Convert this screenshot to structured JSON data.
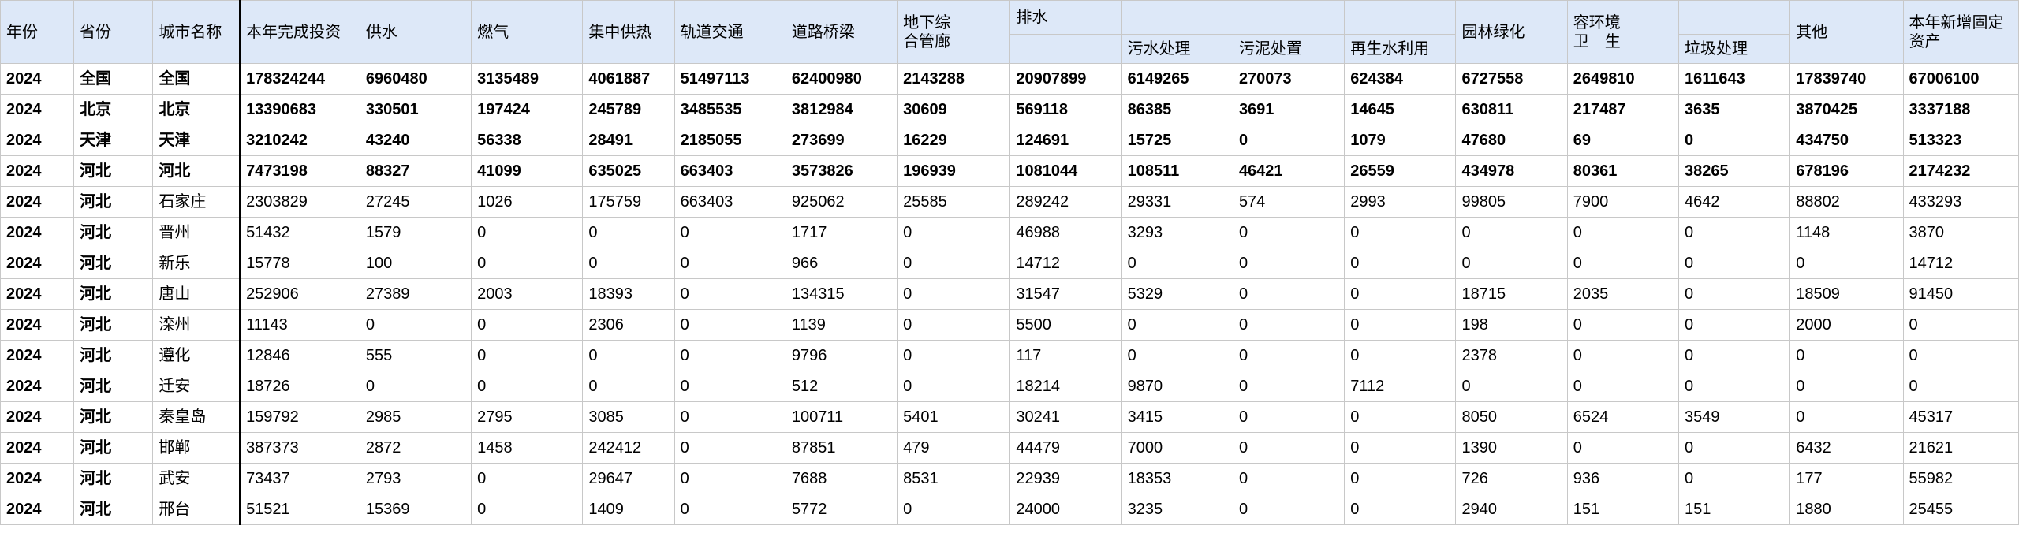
{
  "headers": {
    "year": "年份",
    "province": "省份",
    "city": "城市名称",
    "invest": "本年完成投资",
    "water": "供水",
    "gas": "燃气",
    "heat": "集中供热",
    "rail": "轨道交通",
    "road": "道路桥梁",
    "pipe_line1": "地下综",
    "pipe_line2": "合管廊",
    "drain": "排水",
    "sewage": "污水处理",
    "sludge": "污泥处置",
    "reuse": "再生水利用",
    "green": "园林绿化",
    "env_line1": "容环境",
    "env_line2": "卫　生",
    "garbage": "垃圾处理",
    "other": "其他",
    "fixed_line1": "本年新增固定",
    "fixed_line2": "资产"
  },
  "rows": [
    {
      "bold": true,
      "cells": [
        "2024",
        "全国",
        "全国",
        "178324244",
        "6960480",
        "3135489",
        "4061887",
        "51497113",
        "62400980",
        "2143288",
        "20907899",
        "6149265",
        "270073",
        "624384",
        "6727558",
        "2649810",
        "1611643",
        "17839740",
        "67006100"
      ]
    },
    {
      "bold": true,
      "cells": [
        "2024",
        "北京",
        "北京",
        "13390683",
        "330501",
        "197424",
        "245789",
        "3485535",
        "3812984",
        "30609",
        "569118",
        "86385",
        "3691",
        "14645",
        "630811",
        "217487",
        "3635",
        "3870425",
        "3337188"
      ]
    },
    {
      "bold": true,
      "cells": [
        "2024",
        "天津",
        "天津",
        "3210242",
        "43240",
        "56338",
        "28491",
        "2185055",
        "273699",
        "16229",
        "124691",
        "15725",
        "0",
        "1079",
        "47680",
        "69",
        "0",
        "434750",
        "513323"
      ]
    },
    {
      "bold": true,
      "cells": [
        "2024",
        "河北",
        "河北",
        "7473198",
        "88327",
        "41099",
        "635025",
        "663403",
        "3573826",
        "196939",
        "1081044",
        "108511",
        "46421",
        "26559",
        "434978",
        "80361",
        "38265",
        "678196",
        "2174232"
      ]
    },
    {
      "bold": false,
      "cells": [
        "2024",
        "河北",
        "石家庄",
        "2303829",
        "27245",
        "1026",
        "175759",
        "663403",
        "925062",
        "25585",
        "289242",
        "29331",
        "574",
        "2993",
        "99805",
        "7900",
        "4642",
        "88802",
        "433293"
      ]
    },
    {
      "bold": false,
      "cells": [
        "2024",
        "河北",
        "晋州",
        "51432",
        "1579",
        "0",
        "0",
        "0",
        "1717",
        "0",
        "46988",
        "3293",
        "0",
        "0",
        "0",
        "0",
        "0",
        "1148",
        "3870"
      ]
    },
    {
      "bold": false,
      "cells": [
        "2024",
        "河北",
        "新乐",
        "15778",
        "100",
        "0",
        "0",
        "0",
        "966",
        "0",
        "14712",
        "0",
        "0",
        "0",
        "0",
        "0",
        "0",
        "0",
        "14712"
      ]
    },
    {
      "bold": false,
      "cells": [
        "2024",
        "河北",
        "唐山",
        "252906",
        "27389",
        "2003",
        "18393",
        "0",
        "134315",
        "0",
        "31547",
        "5329",
        "0",
        "0",
        "18715",
        "2035",
        "0",
        "18509",
        "91450"
      ]
    },
    {
      "bold": false,
      "cells": [
        "2024",
        "河北",
        "滦州",
        "11143",
        "0",
        "0",
        "2306",
        "0",
        "1139",
        "0",
        "5500",
        "0",
        "0",
        "0",
        "198",
        "0",
        "0",
        "2000",
        "0"
      ]
    },
    {
      "bold": false,
      "cells": [
        "2024",
        "河北",
        "遵化",
        "12846",
        "555",
        "0",
        "0",
        "0",
        "9796",
        "0",
        "117",
        "0",
        "0",
        "0",
        "2378",
        "0",
        "0",
        "0",
        "0"
      ]
    },
    {
      "bold": false,
      "cells": [
        "2024",
        "河北",
        "迁安",
        "18726",
        "0",
        "0",
        "0",
        "0",
        "512",
        "0",
        "18214",
        "9870",
        "0",
        "7112",
        "0",
        "0",
        "0",
        "0",
        "0"
      ]
    },
    {
      "bold": false,
      "cells": [
        "2024",
        "河北",
        "秦皇岛",
        "159792",
        "2985",
        "2795",
        "3085",
        "0",
        "100711",
        "5401",
        "30241",
        "3415",
        "0",
        "0",
        "8050",
        "6524",
        "3549",
        "0",
        "45317"
      ]
    },
    {
      "bold": false,
      "cells": [
        "2024",
        "河北",
        "邯郸",
        "387373",
        "2872",
        "1458",
        "242412",
        "0",
        "87851",
        "479",
        "44479",
        "7000",
        "0",
        "0",
        "1390",
        "0",
        "0",
        "6432",
        "21621"
      ]
    },
    {
      "bold": false,
      "cells": [
        "2024",
        "河北",
        "武安",
        "73437",
        "2793",
        "0",
        "29647",
        "0",
        "7688",
        "8531",
        "22939",
        "18353",
        "0",
        "0",
        "726",
        "936",
        "0",
        "177",
        "55982"
      ]
    },
    {
      "bold": false,
      "cells": [
        "2024",
        "河北",
        "邢台",
        "51521",
        "15369",
        "0",
        "1409",
        "0",
        "5772",
        "0",
        "24000",
        "3235",
        "0",
        "0",
        "2940",
        "151",
        "151",
        "1880",
        "25455"
      ]
    }
  ]
}
